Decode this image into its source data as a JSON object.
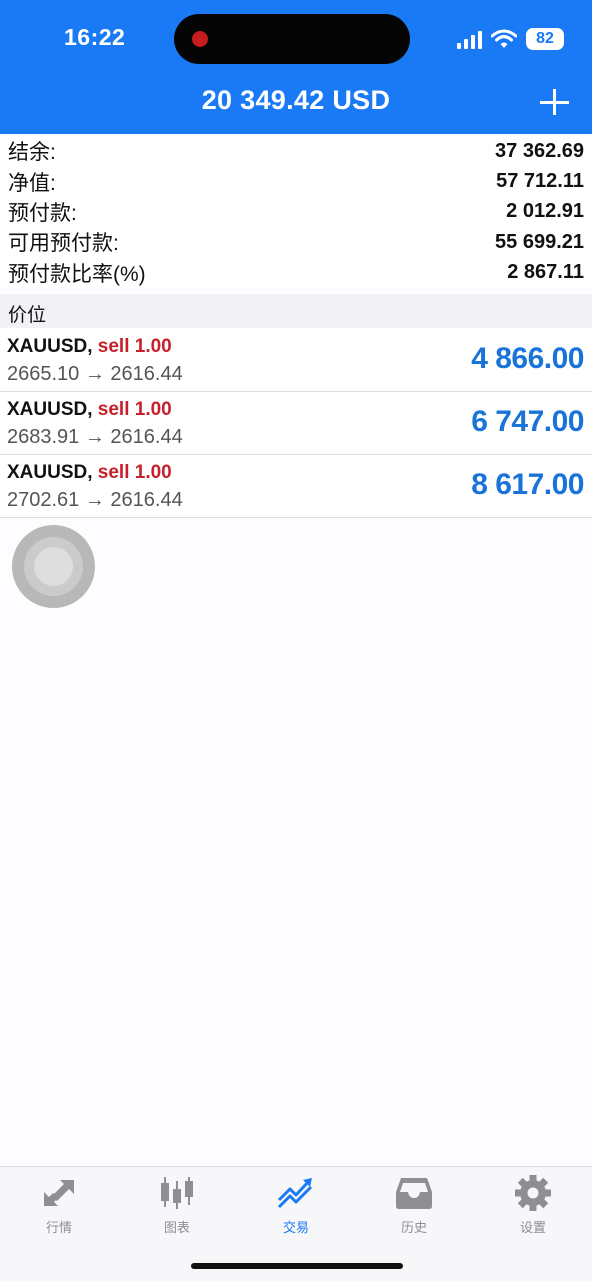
{
  "status_bar": {
    "time": "16:22",
    "battery": "82"
  },
  "header": {
    "balance_title": "20 349.42 USD",
    "add_icon": "plus-icon"
  },
  "summary": [
    {
      "label": "结余:",
      "value": "37 362.69"
    },
    {
      "label": "净值:",
      "value": "57 712.11"
    },
    {
      "label": "预付款:",
      "value": "2 012.91"
    },
    {
      "label": "可用预付款:",
      "value": "55 699.21"
    },
    {
      "label": "预付款比率(%)",
      "value": "2 867.11"
    }
  ],
  "section_title": "价位",
  "positions": [
    {
      "symbol": "XAUUSD,",
      "side": "sell 1.00",
      "prices": "2665.10 → 2616.44",
      "profit": "4 866.00"
    },
    {
      "symbol": "XAUUSD,",
      "side": "sell 1.00",
      "prices": "2683.91 → 2616.44",
      "profit": "6 747.00"
    },
    {
      "symbol": "XAUUSD,",
      "side": "sell 1.00",
      "prices": "2702.61 → 2616.44",
      "profit": "8 617.00"
    }
  ],
  "tabs": [
    {
      "label": "行情",
      "icon": "quotes-arrows-icon"
    },
    {
      "label": "图表",
      "icon": "candlestick-chart-icon"
    },
    {
      "label": "交易",
      "icon": "trade-trend-icon"
    },
    {
      "label": "历史",
      "icon": "history-tray-icon"
    },
    {
      "label": "设置",
      "icon": "settings-gear-icon"
    }
  ],
  "colors": {
    "header_blue": "#1a7af5",
    "profit_blue": "#1a73d8",
    "sell_red": "#c8202a"
  }
}
